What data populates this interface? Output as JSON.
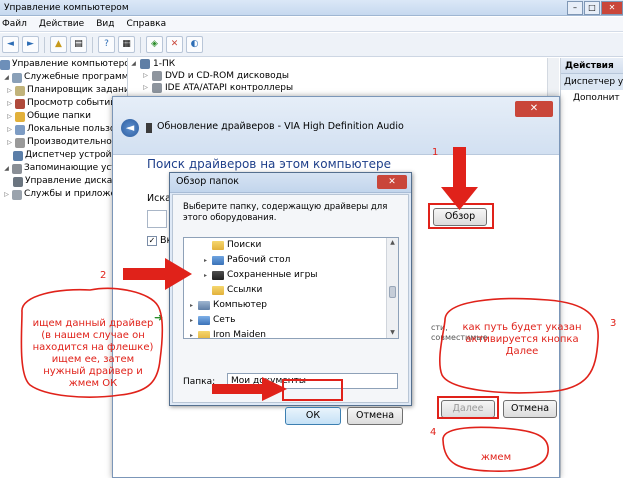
{
  "mmc": {
    "title": "Управление компьютером",
    "menu": [
      "Файл",
      "Действие",
      "Вид",
      "Справка"
    ],
    "toolbar_icons": [
      "back-arrow-icon",
      "forward-arrow-icon",
      "up-folder-icon",
      "tree-icon",
      "help-icon",
      "properties-icon",
      "scan-icon",
      "remove-icon",
      "disable-icon"
    ],
    "tree": [
      {
        "label": "Управление компьютером (л",
        "level": 0
      },
      {
        "label": "Служебные программы",
        "level": 1
      },
      {
        "label": "Планировщик заданий",
        "level": 2
      },
      {
        "label": "Просмотр событий",
        "level": 2
      },
      {
        "label": "Общие папки",
        "level": 2
      },
      {
        "label": "Локальные пользова",
        "level": 2
      },
      {
        "label": "Производительность",
        "level": 2
      },
      {
        "label": "Диспетчер устройств",
        "level": 2
      },
      {
        "label": "Запоминающие устройства",
        "level": 1
      },
      {
        "label": "Управление дисками",
        "level": 2
      },
      {
        "label": "Службы и приложения",
        "level": 1
      }
    ],
    "devices": [
      {
        "label": "1-ПК",
        "level": 0
      },
      {
        "label": "DVD и CD-ROM дисководы",
        "level": 1
      },
      {
        "label": "IDE ATA/ATAPI контроллеры",
        "level": 1
      }
    ],
    "actions": {
      "header": "Действия",
      "section": "Диспетчер устр",
      "item": "Дополнит"
    }
  },
  "wizard": {
    "title": "Обновление драйверов - VIA High Definition Audio",
    "close": "✕",
    "heading": "Поиск драйверов на этом компьютере",
    "search_label": "Искать",
    "check_label": "Вкл",
    "browse_button": "Обзор",
    "next_button": "Далее",
    "cancel_button": "Отмена",
    "hint": "сти, совместимые"
  },
  "browse": {
    "title": "Обзор папок",
    "close": "✕",
    "description": "Выберите папку, содержащую драйверы для этого оборудования.",
    "items": [
      {
        "label": "Поиски",
        "level": 1,
        "expander": ""
      },
      {
        "label": "Рабочий стол",
        "level": 1,
        "expander": "▸"
      },
      {
        "label": "Сохраненные игры",
        "level": 1,
        "expander": "▸"
      },
      {
        "label": "Ссылки",
        "level": 1,
        "expander": ""
      },
      {
        "label": "Компьютер",
        "level": 0,
        "expander": "▸"
      },
      {
        "label": "Сеть",
        "level": 0,
        "expander": "▸"
      },
      {
        "label": "Iron Maiden",
        "level": 0,
        "expander": "▸"
      }
    ],
    "folder_label": "Папка:",
    "folder_value": "Мои документы",
    "ok_button": "ОК",
    "cancel_button": "Отмена"
  },
  "annotations": {
    "step1": "1",
    "step2": "2",
    "step3": "3",
    "step4": "4",
    "note_left": "ищем данный драйвер (в нашем случае он находится на флешке) ищем ее, затем нужный драйвер и жмем ОК",
    "note_right": "как путь будет указан активируется кнопка Далее",
    "note_bottom": "жмем",
    "color": "#e0221a"
  }
}
